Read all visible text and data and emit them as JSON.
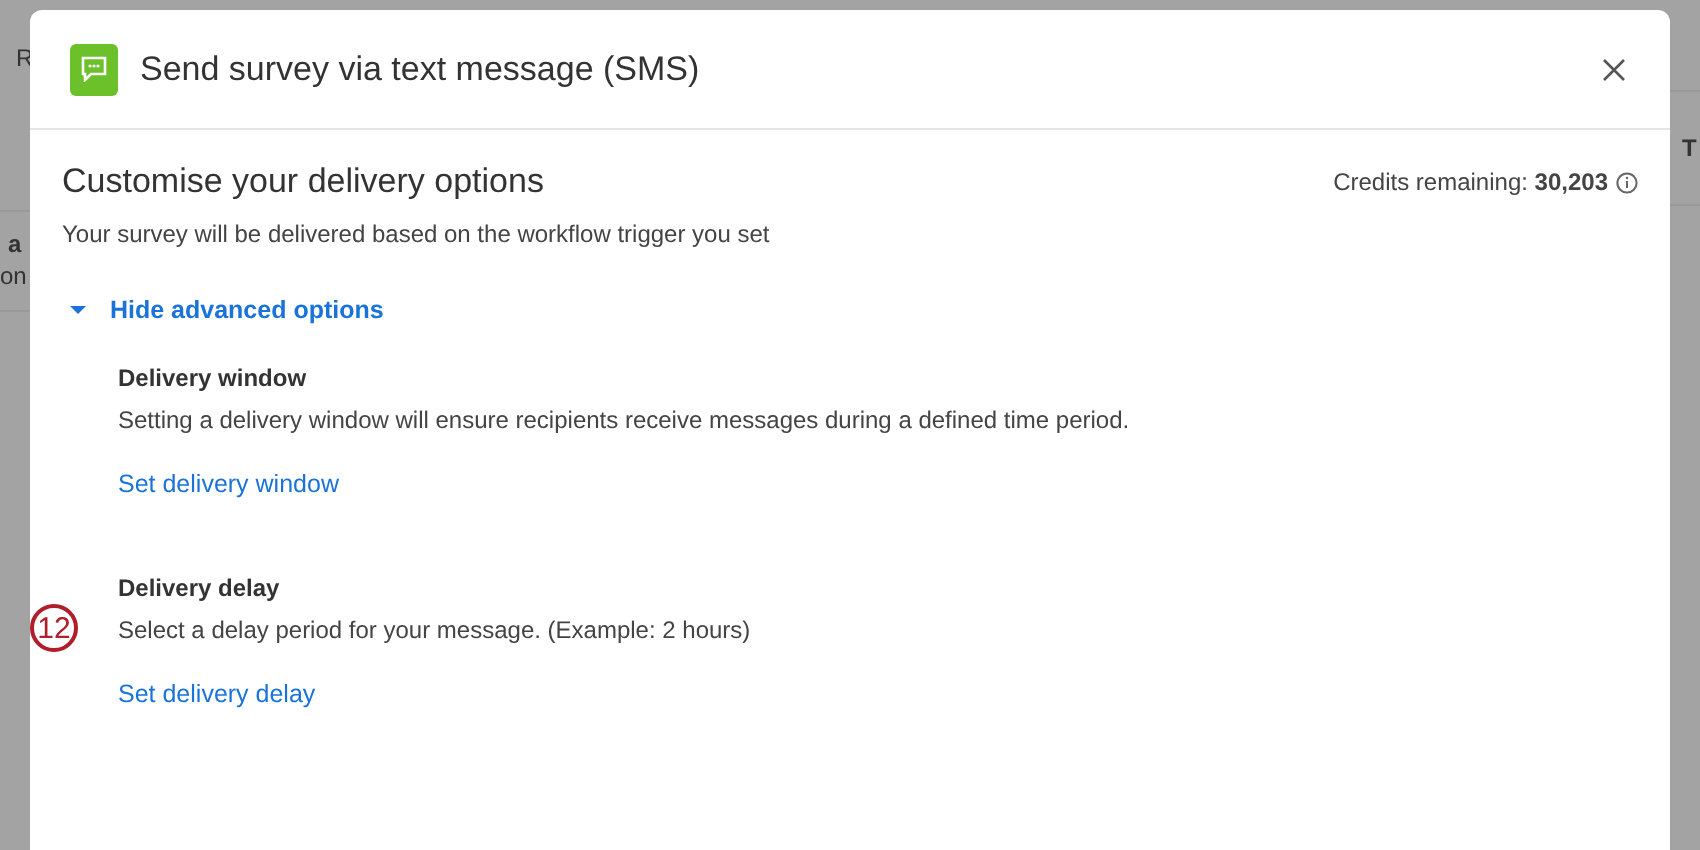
{
  "background_page": {
    "fragments": [
      {
        "text": "R",
        "kind": "plain"
      },
      {
        "text": "a",
        "kind": "bold"
      },
      {
        "text": "on",
        "kind": "plain"
      },
      {
        "text": "T",
        "kind": "bold"
      }
    ]
  },
  "dialog": {
    "title": "Send survey via text message (SMS)",
    "heading": "Customise your delivery options",
    "credits_label": "Credits remaining:",
    "credits_value": "30,203",
    "subtitle": "Your survey will be delivered based on the workflow trigger you set",
    "advanced_toggle": {
      "label": "Hide advanced options",
      "expanded": true
    },
    "sections": [
      {
        "title": "Delivery window",
        "description": "Setting a delivery window will ensure recipients receive messages during a defined time period.",
        "link": "Set delivery window"
      },
      {
        "title": "Delivery delay",
        "description": "Select a delay period for your message. (Example: 2 hours)",
        "link": "Set delivery delay"
      }
    ]
  },
  "annotation": {
    "number": "12"
  }
}
